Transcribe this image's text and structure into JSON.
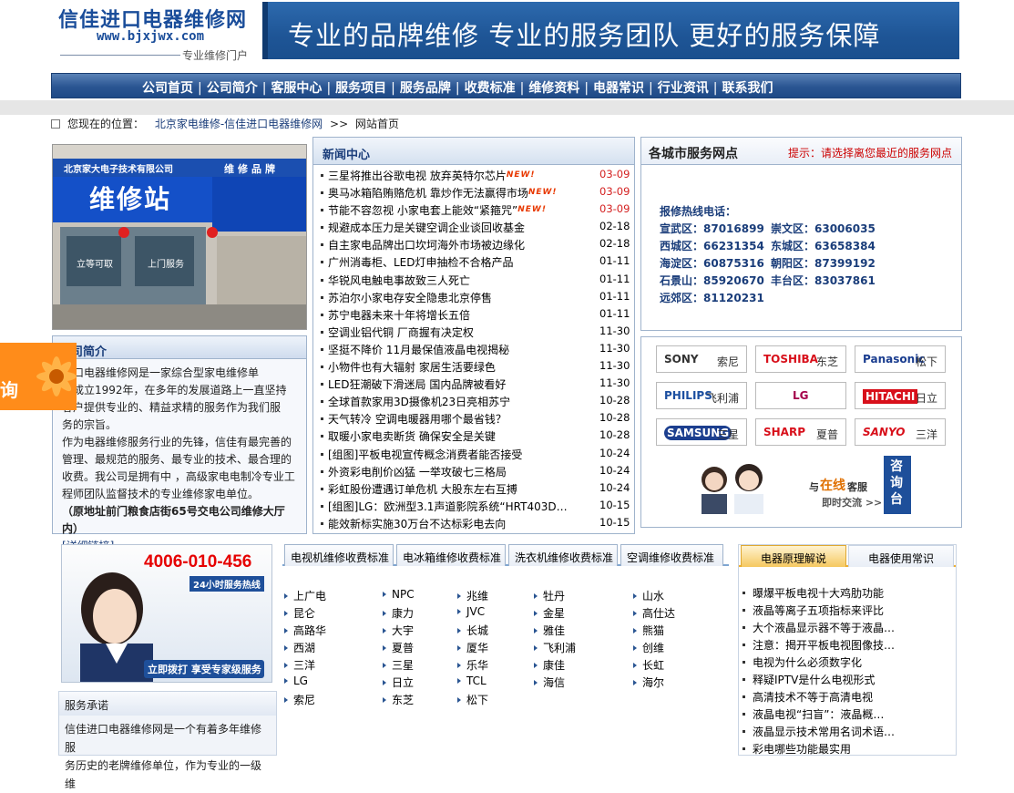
{
  "header": {
    "site_name": "信佳进口电器维修网",
    "site_url": "www.bjxjwx.com",
    "tagline": "专业维修门户",
    "banner_text": "专业的品牌维修  专业的服务团队  更好的服务保障"
  },
  "nav": {
    "items": [
      "公司首页",
      "公司简介",
      "客服中心",
      "服务项目",
      "服务品牌",
      "收费标准",
      "维修资料",
      "电器常识",
      "行业资讯",
      "联系我们"
    ],
    "separator": "|"
  },
  "breadcrumb": {
    "label": "您现在的位置：",
    "link": "北京家电维修-信佳进口电器维修网",
    "sep": ">>",
    "current": "网站首页"
  },
  "photo": {
    "shop_sign": "北京家大电子技术有限公司",
    "big_sign": "维修站",
    "side_sign": "维修品牌",
    "door1": "立等可取",
    "door2": "上门服务"
  },
  "about": {
    "title": "司简介",
    "lines": [
      "进口电器维修网是一家综合型家电维修单",
      "，成立1992年，在多年的发展道路上一直坚持",
      "客户提供专业的、精益求精的服务作为我们服",
      "务的宗旨。",
      "作为电器维修服务行业的先锋，信佳有最完善的",
      "管理、最规范的服务、最专业的技术、最合理的",
      "收费。我公司是拥有中  ，高级家电电制冷专业工",
      "程师团队监督技术的专业维修家电单位。"
    ],
    "address": "（原地址前门粮食店街65号交电公司维修大厅内）",
    "more": "[详细链接]",
    "float_text": "询"
  },
  "news": {
    "title": "新闻中心",
    "new_badge": "NEW!",
    "items": [
      {
        "title": "三星将推出谷歌电视 放弃英特尔芯片",
        "date": "03-09",
        "new": true
      },
      {
        "title": "奥马冰箱陷贿赂危机 靠炒作无法赢得市场",
        "date": "03-09",
        "new": true
      },
      {
        "title": "节能不容忽视 小家电套上能效“紧箍咒”",
        "date": "03-09",
        "new": true
      },
      {
        "title": "规避成本压力是关键空调企业谈回收基金",
        "date": "02-18",
        "new": false
      },
      {
        "title": "自主家电品牌出口坎坷海外市场被边缘化",
        "date": "02-18",
        "new": false
      },
      {
        "title": "广州消毒柜、LED灯申抽检不合格产品",
        "date": "01-11",
        "new": false
      },
      {
        "title": "华锐风电触电事故致三人死亡",
        "date": "01-11",
        "new": false
      },
      {
        "title": "苏泊尔小家电存安全隐患北京停售",
        "date": "01-11",
        "new": false
      },
      {
        "title": "苏宁电器未来十年将增长五倍",
        "date": "01-11",
        "new": false
      },
      {
        "title": "空调业铝代铜 厂商握有决定权",
        "date": "11-30",
        "new": false
      },
      {
        "title": "坚挺不降价 11月最保值液晶电视揭秘",
        "date": "11-30",
        "new": false
      },
      {
        "title": "小物件也有大辐射 家居生活要绿色",
        "date": "11-30",
        "new": false
      },
      {
        "title": "LED狂潮破下滑迷局 国内品牌被看好",
        "date": "11-30",
        "new": false
      },
      {
        "title": "全球首款家用3D摄像机23日亮相苏宁",
        "date": "10-28",
        "new": false
      },
      {
        "title": "天气转冷 空调电暖器用哪个最省钱？",
        "date": "10-28",
        "new": false
      },
      {
        "title": "取暖小家电卖断货 确保安全是关键",
        "date": "10-28",
        "new": false
      },
      {
        "title": "[组图]平板电视宣传概念消费者能否接受",
        "date": "10-24",
        "new": false
      },
      {
        "title": "外资彩电削价凶猛 一举攻破七三格局",
        "date": "10-24",
        "new": false
      },
      {
        "title": "彩虹股份遭遇订单危机 大股东左右互搏",
        "date": "10-24",
        "new": false
      },
      {
        "title": "[组图]LG：欧洲型3.1声道影院系统“HRT403D…",
        "date": "10-15",
        "new": false
      },
      {
        "title": "能效新标实施30万台不达标彩电去向",
        "date": "10-15",
        "new": false
      }
    ]
  },
  "service": {
    "title": "各城市服务网点",
    "tip": "提示：请选择离您最近的服务网点",
    "hotline_label": "报修热线电话：",
    "rows": [
      [
        "宣武区：87016899",
        "崇文区：63006035"
      ],
      [
        "西城区：66231354",
        "东城区：63658384"
      ],
      [
        "海淀区：60875316",
        "朝阳区：87399192"
      ],
      [
        "石景山：85920670",
        "丰台区：83037861"
      ],
      [
        "远郊区：81120231",
        ""
      ]
    ]
  },
  "brand_logos": [
    {
      "en": "SONY",
      "zh": "索尼",
      "color": "#333333"
    },
    {
      "en": "TOSHIBA",
      "zh": "东芝",
      "color": "#d8101b"
    },
    {
      "en": "Panasonic",
      "zh": "松下",
      "color": "#1a3d8f"
    },
    {
      "en": "PHILIPS",
      "zh": "飞利浦",
      "color": "#1c4fa0"
    },
    {
      "en": "LG",
      "zh": "",
      "color": "#a4004a"
    },
    {
      "en": "HITACHI",
      "zh": "日立",
      "color": "#ffffff"
    },
    {
      "en": "SAMSUNG",
      "zh": "三星",
      "color": "#ffffff"
    },
    {
      "en": "SHARP",
      "zh": "夏普",
      "color": "#d8101b"
    },
    {
      "en": "SANYO",
      "zh": "三洋",
      "color": "#d8101b"
    }
  ],
  "consult": {
    "text1": "与",
    "text2": "在线",
    "text3": "客服",
    "text4": "即时交流 >>",
    "vertical": "咨询台"
  },
  "promo": {
    "phone": "4006-010-456",
    "sub": "24小时服务热线",
    "cta": "立即拨打  享受专家级服务"
  },
  "promise": {
    "title": "服务承诺",
    "lines": [
      "信佳进口电器维修网是一个有着多年维修服",
      "务历史的老牌维修单位，作为专业的一级维"
    ]
  },
  "prices": {
    "tabs": [
      "电视机维修收费标准",
      "电冰箱维修收费标准",
      "洗衣机维修收费标准",
      "空调维修收费标准"
    ],
    "brands": [
      [
        "上广电",
        "NPC",
        "兆维",
        "牡丹",
        "山水"
      ],
      [
        "昆仑",
        "康力",
        "JVC",
        "金星",
        "高仕达"
      ],
      [
        "高路华",
        "大宇",
        "长城",
        "雅佳",
        "熊猫"
      ],
      [
        "西湖",
        "夏普",
        "厦华",
        "飞利浦",
        "创维"
      ],
      [
        "三洋",
        "三星",
        "乐华",
        "康佳",
        "长虹"
      ],
      [
        "LG",
        "日立",
        "TCL",
        "海信",
        "海尔"
      ],
      [
        "索尼",
        "东芝",
        "松下",
        "",
        ""
      ]
    ]
  },
  "knowledge": {
    "tabs": [
      "电器原理解说",
      "电器使用常识"
    ],
    "items": [
      "曝爆平板电视十大鸡肋功能",
      "液晶等离子五项指标来评比",
      "大个液晶显示器不等于液晶…",
      "注意：揭开平板电视图像技…",
      "电视为什么必须数字化",
      "释疑IPTV是什么电视形式",
      "高清技术不等于高清电视",
      "液晶电视“扫盲”：液晶概…",
      "液晶显示技术常用名词术语…",
      "彩电哪些功能最实用"
    ]
  }
}
